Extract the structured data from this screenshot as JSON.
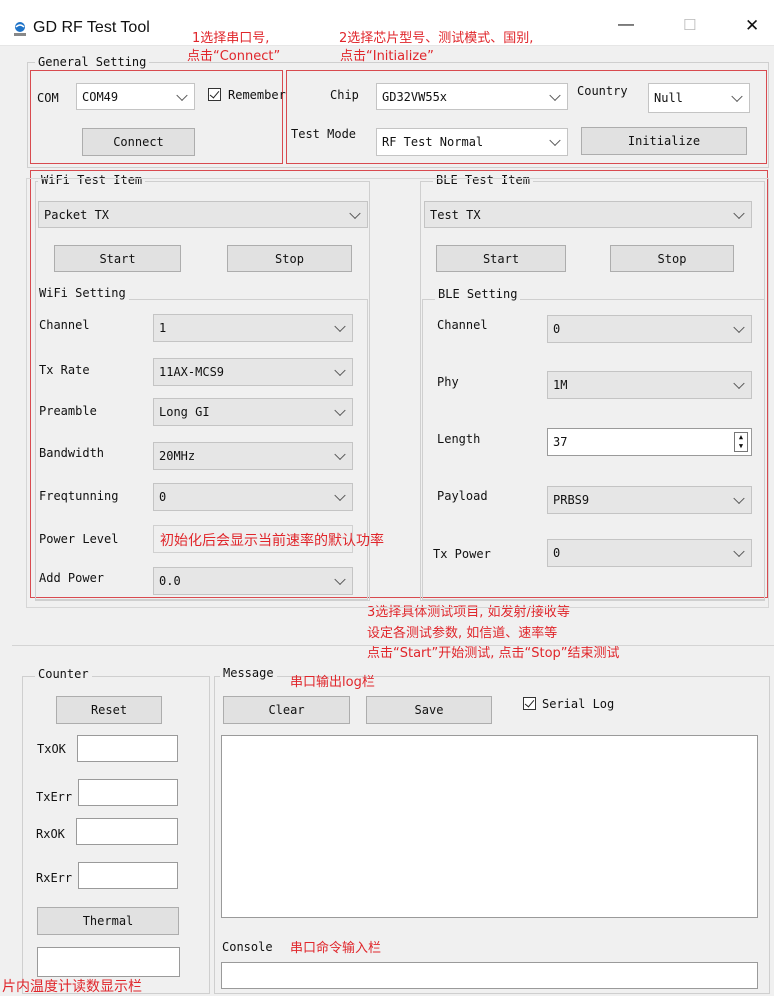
{
  "window": {
    "title": "GD RF Test Tool",
    "minimize_glyph": "—",
    "maximize_glyph": "☐",
    "close_glyph": "✕"
  },
  "general": {
    "legend": "General Setting",
    "com_label": "COM",
    "com_value": "COM49",
    "remember_label": "Remember",
    "remember_checked": true,
    "connect_label": "Connect",
    "chip_label": "Chip",
    "chip_value": "GD32VW55x",
    "country_label": "Country",
    "country_value": "Null",
    "test_mode_label": "Test Mode",
    "test_mode_value": "RF Test Normal",
    "initialize_label": "Initialize"
  },
  "wifi": {
    "item_legend": "WiFi Test Item",
    "item_value": "Packet TX",
    "start_label": "Start",
    "stop_label": "Stop",
    "setting_legend": "WiFi Setting",
    "rows": [
      {
        "label": "Channel",
        "value": "1"
      },
      {
        "label": "Tx Rate",
        "value": "11AX-MCS9"
      },
      {
        "label": "Preamble",
        "value": "Long GI"
      },
      {
        "label": "Bandwidth",
        "value": "20MHz"
      },
      {
        "label": "Freqtunning",
        "value": "0"
      },
      {
        "label": "Power Level",
        "value": ""
      },
      {
        "label": "Add Power",
        "value": "0.0"
      }
    ]
  },
  "ble": {
    "item_legend": "BLE Test Item",
    "item_value": "Test TX",
    "start_label": "Start",
    "stop_label": "Stop",
    "setting_legend": "BLE Setting",
    "channel_label": "Channel",
    "channel_value": "0",
    "phy_label": "Phy",
    "phy_value": "1M",
    "length_label": "Length",
    "length_value": "37",
    "payload_label": "Payload",
    "payload_value": "PRBS9",
    "txpower_label": "Tx Power",
    "txpower_value": "0"
  },
  "counter": {
    "legend": "Counter",
    "reset_label": "Reset",
    "txok_label": "TxOK",
    "txerr_label": "TxErr",
    "rxok_label": "RxOK",
    "rxerr_label": "RxErr",
    "thermal_label": "Thermal"
  },
  "message": {
    "legend": "Message",
    "clear_label": "Clear",
    "save_label": "Save",
    "serial_log_label": "Serial Log",
    "serial_log_checked": true,
    "console_label": "Console"
  },
  "annotations": {
    "step1_line1": "1选择串口号,",
    "step1_line2": "点击“Connect”",
    "step2_line1": "2选择芯片型号、测试模式、国别,",
    "step2_line2": "点击“Initialize”",
    "power_level_note": "初始化后会显示当前速率的默认功率",
    "step3_line1": "3选择具体测试项目, 如发射/接收等",
    "step3_line2": "设定各测试参数, 如信道、速率等",
    "step3_line3": "点击“Start”开始测试, 点击“Stop”结束测试",
    "log_note": "串口输出log栏",
    "console_note": "串口命令输入栏",
    "thermal_note": "片内温度计读数显示栏"
  },
  "colors": {
    "annotation_red": "#e0262b",
    "window_bg": "#f0f0f0",
    "app_icon_blue": "#1e73c8"
  }
}
